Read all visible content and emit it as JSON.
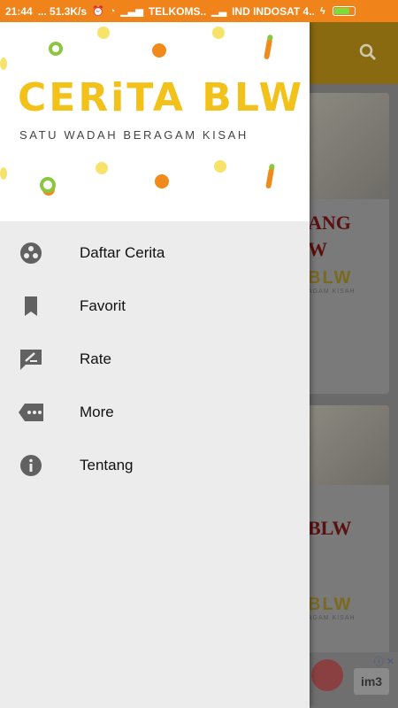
{
  "status_bar": {
    "time": "21:44",
    "speed": "... 51.3K/s",
    "carrier1": "TELKOMS..",
    "carrier2": "IND INDOSAT 4.."
  },
  "header": {
    "logo_title": "CERiTA BLW",
    "logo_subtitle": "SATU WADAH BERAGAM KISAH"
  },
  "menu": [
    {
      "label": "Daftar Cerita",
      "icon": "stories-icon"
    },
    {
      "label": "Favorit",
      "icon": "bookmark-icon"
    },
    {
      "label": "Rate",
      "icon": "rate-icon"
    },
    {
      "label": "More",
      "icon": "more-icon"
    },
    {
      "label": "Tentang",
      "icon": "info-icon"
    }
  ],
  "background": {
    "card1_text": "ANG\nW",
    "card2_text": "BLW",
    "logo_small": "BLW",
    "logo_small_sub": "AGAM KISAH",
    "ad_text": "im3"
  },
  "colors": {
    "status_bar": "#f0831a",
    "logo_yellow": "#f2c21a",
    "logo_green": "#8cc63f",
    "logo_orange": "#f08a1a",
    "drawer_bg": "#ececec",
    "icon_grey": "#616161"
  }
}
